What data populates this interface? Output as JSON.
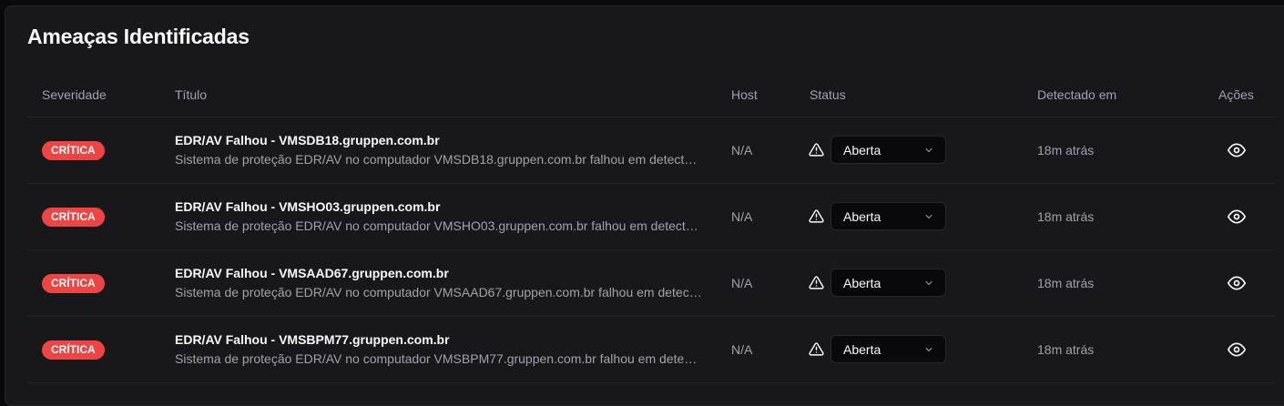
{
  "panel": {
    "title": "Ameaças Identificadas"
  },
  "table": {
    "headers": {
      "severity": "Severidade",
      "title": "Título",
      "host": "Host",
      "status": "Status",
      "detected": "Detectado em",
      "actions": "Ações"
    },
    "rows": [
      {
        "severity": "CRÍTICA",
        "title": "EDR/AV Falhou - VMSDB18.gruppen.com.br",
        "description": "Sistema de proteção EDR/AV no computador VMSDB18.gruppen.com.br falhou em detectar ou responder à ameaça",
        "host": "N/A",
        "status": "Aberta",
        "detected": "18m atrás"
      },
      {
        "severity": "CRÍTICA",
        "title": "EDR/AV Falhou - VMSHO03.gruppen.com.br",
        "description": "Sistema de proteção EDR/AV no computador VMSHO03.gruppen.com.br falhou em detectar ou responder à ameaça",
        "host": "N/A",
        "status": "Aberta",
        "detected": "18m atrás"
      },
      {
        "severity": "CRÍTICA",
        "title": "EDR/AV Falhou - VMSAAD67.gruppen.com.br",
        "description": "Sistema de proteção EDR/AV no computador VMSAAD67.gruppen.com.br falhou em detectar ou responder à ameaça",
        "host": "N/A",
        "status": "Aberta",
        "detected": "18m atrás"
      },
      {
        "severity": "CRÍTICA",
        "title": "EDR/AV Falhou - VMSBPM77.gruppen.com.br",
        "description": "Sistema de proteção EDR/AV no computador VMSBPM77.gruppen.com.br falhou em detectar ou responder à ameaça",
        "host": "N/A",
        "status": "Aberta",
        "detected": "18m atrás"
      }
    ]
  },
  "icons": {
    "status": "alert-triangle-icon",
    "select": "chevron-down-icon",
    "action": "eye-icon"
  },
  "colors": {
    "background": "#09090b",
    "card": "#18181b",
    "border": "#27272a",
    "critical": "#ef4444",
    "text": "#fafafa",
    "muted": "#a1a1aa"
  }
}
